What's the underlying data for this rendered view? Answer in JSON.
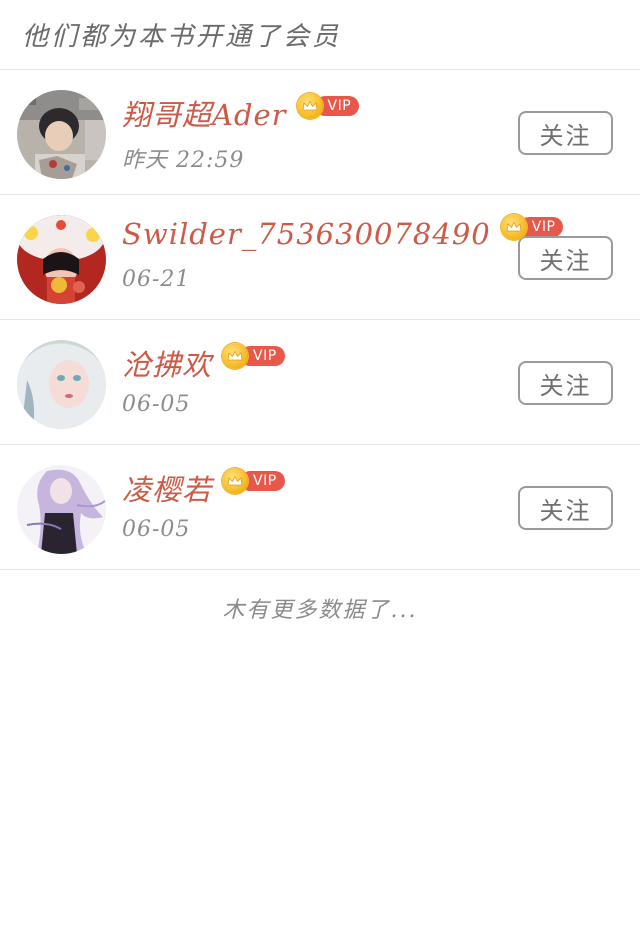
{
  "header": {
    "title": "他们都为本书开通了会员"
  },
  "members": [
    {
      "name": "翔哥超Ader",
      "time": "昨天 22:59",
      "vip": "VIP",
      "follow": "关注",
      "avatar": "avatar-boy-photo"
    },
    {
      "name": "Swilder_753630078490",
      "time": "06-21",
      "vip": "VIP",
      "follow": "关注",
      "avatar": "avatar-lion-dance-girl"
    },
    {
      "name": "沧拂欢",
      "time": "06-05",
      "vip": "VIP",
      "follow": "关注",
      "avatar": "avatar-white-hair-girl"
    },
    {
      "name": "凌樱若",
      "time": "06-05",
      "vip": "VIP",
      "follow": "关注",
      "avatar": "avatar-purple-hair-girl"
    }
  ],
  "footer": {
    "note": "木有更多数据了..."
  },
  "colors": {
    "name": "#cc5a46",
    "vip_pill": "#e8584a",
    "crown": "#f4b51b",
    "divider": "#e8e8e8"
  }
}
